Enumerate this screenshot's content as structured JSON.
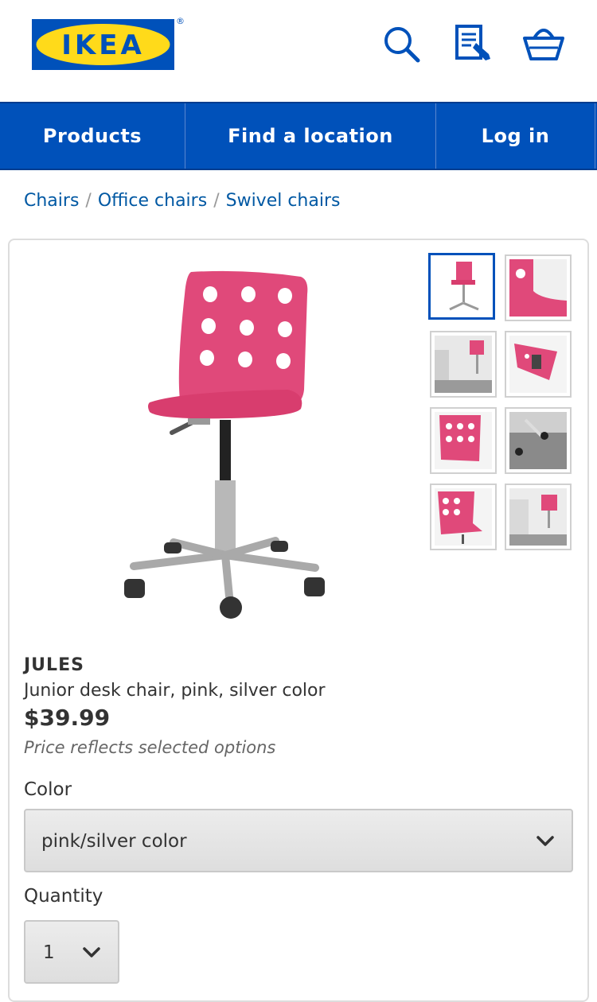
{
  "header": {
    "logo_text": "IKEA",
    "registered_mark": "®",
    "icons": [
      "search-icon",
      "shopping-list-icon",
      "cart-icon"
    ]
  },
  "nav": {
    "items": [
      {
        "label": "Products"
      },
      {
        "label": "Find a location"
      },
      {
        "label": "Log in"
      }
    ]
  },
  "breadcrumb": {
    "items": [
      "Chairs",
      "Office chairs",
      "Swivel chairs"
    ],
    "separator": "/"
  },
  "product": {
    "name": "JULES",
    "description": "Junior desk chair, pink, silver color",
    "price": "$39.99",
    "price_note": "Price reflects selected options",
    "thumbnails_count": 8
  },
  "options": {
    "color_label": "Color",
    "color_value": "pink/silver color",
    "quantity_label": "Quantity",
    "quantity_value": "1"
  },
  "colors": {
    "brand_blue": "#0051ba",
    "brand_yellow": "#ffda1a",
    "link_blue": "#0058a3",
    "chair_pink": "#e0497a"
  }
}
